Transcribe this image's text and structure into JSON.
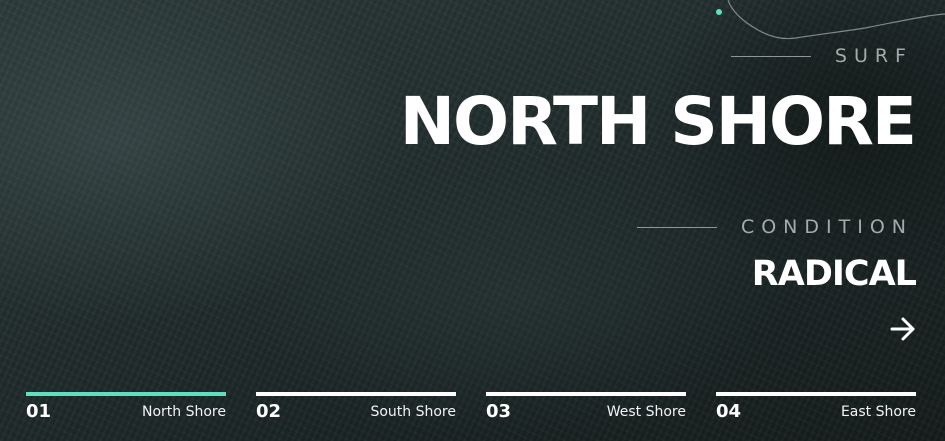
{
  "hero": {
    "kicker": "SURF",
    "title": "NORTH SHORE",
    "condition_kicker": "CONDITION",
    "condition_value": "RADICAL",
    "next_icon": "arrow-right-icon"
  },
  "tabs": [
    {
      "number": "01",
      "label": "North Shore",
      "active": true
    },
    {
      "number": "02",
      "label": "South Shore",
      "active": false
    },
    {
      "number": "03",
      "label": "West Shore",
      "active": false
    },
    {
      "number": "04",
      "label": "East Shore",
      "active": false
    }
  ],
  "colors": {
    "accent": "#5ee0c0",
    "text": "#ffffff",
    "muted": "#a3acaa",
    "background": "#1b2424"
  }
}
